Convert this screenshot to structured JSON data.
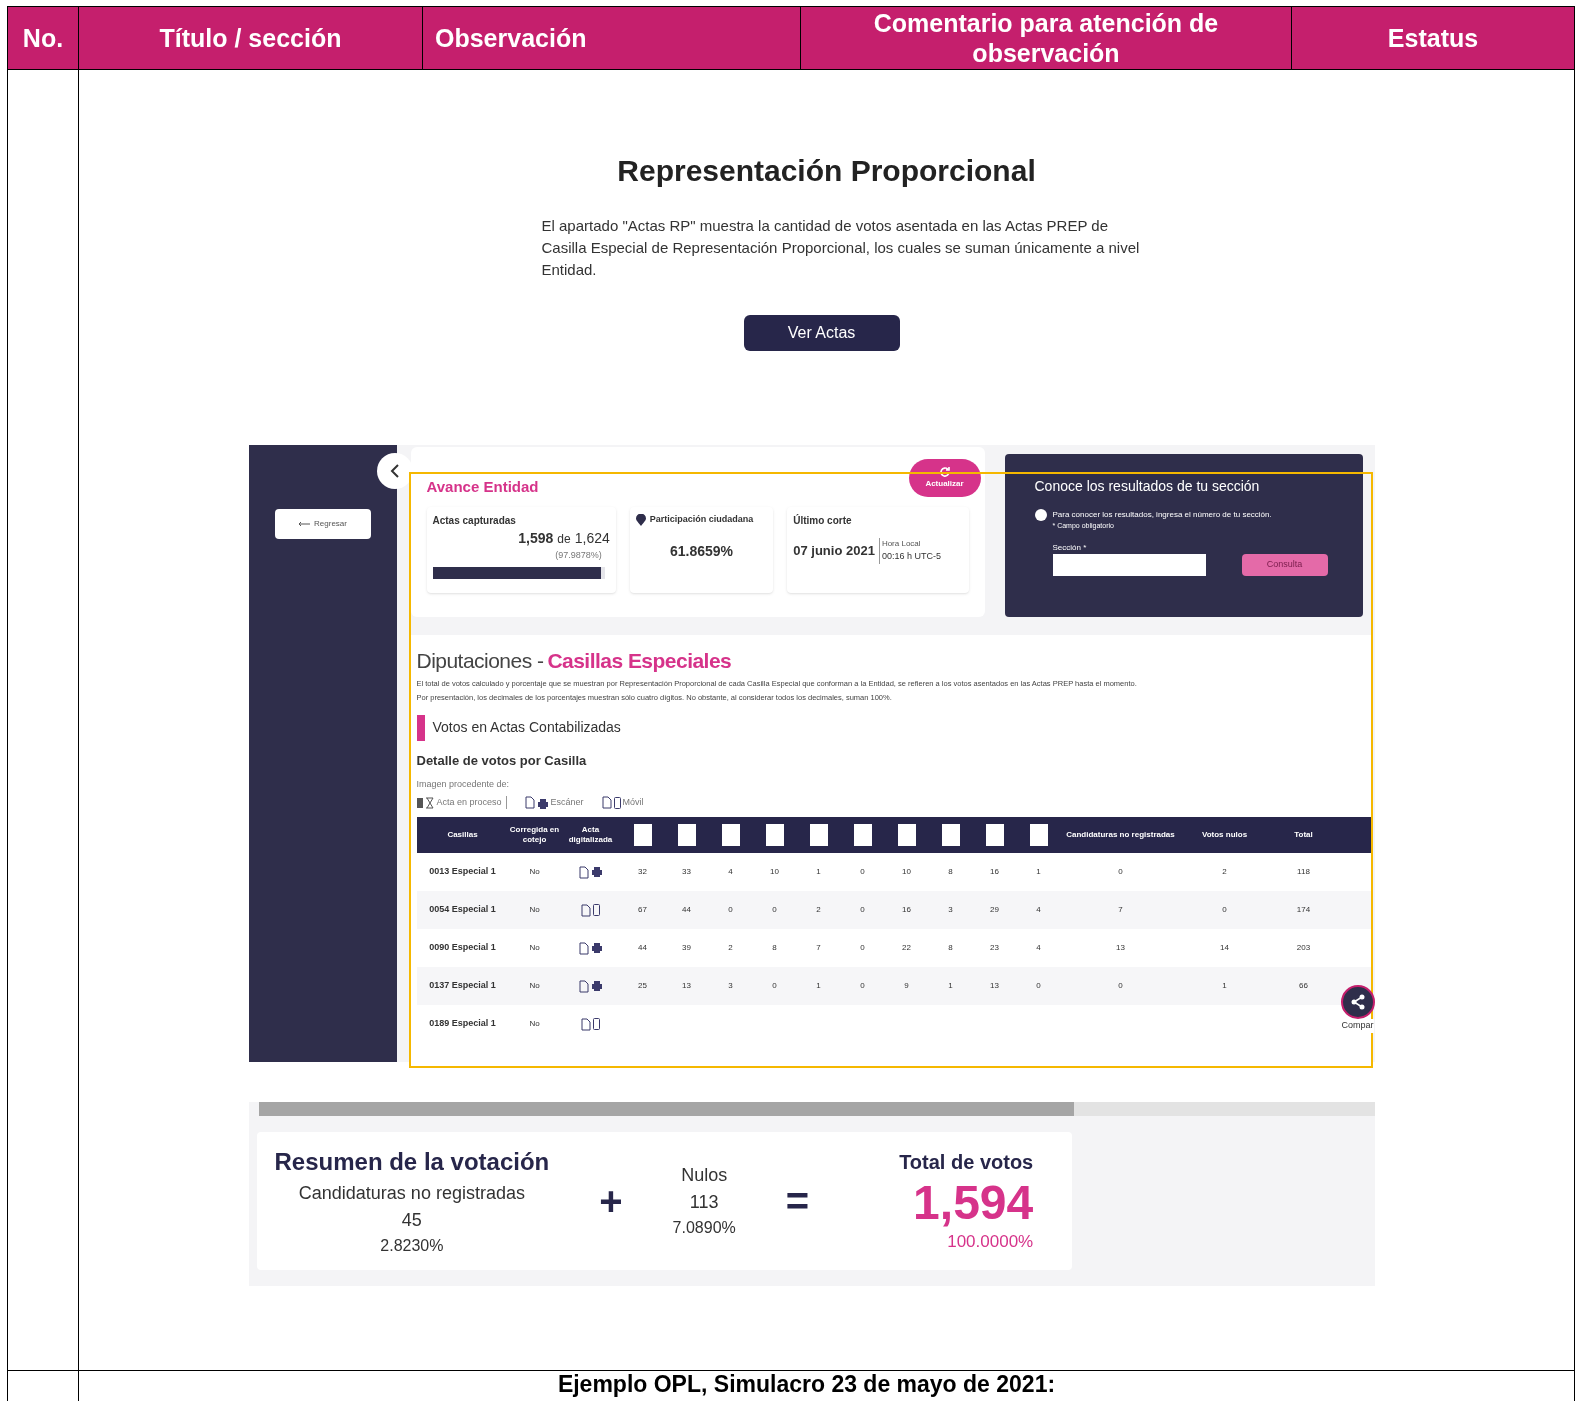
{
  "doc_table": {
    "columns": [
      "No.",
      "Título / sección",
      "Observación",
      "Comentario para atención de observación",
      "Estatus"
    ],
    "embedded_page": {
      "title": "Representación Proporcional",
      "description": "El apartado \"Actas RP\" muestra la cantidad de votos asentada en las Actas PREP de Casilla Especial de Representación Proporcional, los cuales se suman únicamente a nivel Entidad.",
      "button": "Ver Actas"
    },
    "app_screenshot": {
      "back_button": "Regresar",
      "avance": {
        "title": "Avance Entidad",
        "refresh_button": "Actualizar",
        "actas": {
          "label": "Actas capturadas",
          "count": "1,598",
          "of": "de",
          "total": "1,624",
          "percent": "(97.9878%)",
          "level": 0.98
        },
        "participacion": {
          "label": "Participación ciudadana",
          "value": "61.8659%"
        },
        "corte": {
          "label": "Último corte",
          "date": "07 junio 2021",
          "time_label": "Hora Local",
          "time": "00:16 h UTC-5"
        }
      },
      "seccion_panel": {
        "title": "Conoce los resultados de tu sección",
        "hint": "Para conocer los resultados, ingresa el número de tu sección.",
        "required_note": "* Campo obligatorio",
        "field_label": "Sección *",
        "button": "Consulta"
      },
      "diputaciones": {
        "title": "Diputaciones -",
        "title_highlight": "Casillas Especiales",
        "notes": [
          "El total de votos calculado y porcentaje que se muestran por Representación Proporcional de cada Casilla Especial que conforman a la Entidad, se refieren a los votos asentados en las Actas PREP hasta el momento.",
          "Por presentación, los decimales de los porcentajes muestran sólo cuatro dígitos. No obstante, al considerar todos los decimales, suman 100%."
        ],
        "subsection": "Votos en Actas Contabilizadas",
        "detail_title": "Detalle de votos por Casilla",
        "legend_label": "Imagen procedente de:",
        "legend": [
          {
            "kind": "proceso",
            "label": "Acta en proceso"
          },
          {
            "kind": "escaner",
            "label": "Escáner"
          },
          {
            "kind": "movil",
            "label": "Móvil"
          }
        ],
        "table": {
          "columns": [
            {
              "kind": "text",
              "label": "Casillas"
            },
            {
              "kind": "text",
              "label": "Corregida en cotejo"
            },
            {
              "kind": "text",
              "label": "Acta digitalizada"
            },
            {
              "kind": "logo"
            },
            {
              "kind": "logo"
            },
            {
              "kind": "logo"
            },
            {
              "kind": "logo"
            },
            {
              "kind": "logo"
            },
            {
              "kind": "logo"
            },
            {
              "kind": "logo"
            },
            {
              "kind": "logo"
            },
            {
              "kind": "logo"
            },
            {
              "kind": "logo"
            },
            {
              "kind": "text",
              "label": "Candidaturas no registradas"
            },
            {
              "kind": "text",
              "label": "Votos nulos"
            },
            {
              "kind": "text",
              "label": "Total"
            }
          ],
          "rows": [
            {
              "casilla": "0013 Especial 1",
              "corregida": "No",
              "kind": "escaner",
              "values": [
                "32",
                "33",
                "4",
                "10",
                "1",
                "0",
                "10",
                "8",
                "16",
                "1",
                "0",
                "2",
                "118"
              ]
            },
            {
              "casilla": "0054 Especial 1",
              "corregida": "No",
              "kind": "movil",
              "values": [
                "67",
                "44",
                "0",
                "0",
                "2",
                "0",
                "16",
                "3",
                "29",
                "4",
                "7",
                "0",
                "174"
              ]
            },
            {
              "casilla": "0090 Especial 1",
              "corregida": "No",
              "kind": "escaner",
              "values": [
                "44",
                "39",
                "2",
                "8",
                "7",
                "0",
                "22",
                "8",
                "23",
                "4",
                "13",
                "14",
                "203"
              ]
            },
            {
              "casilla": "0137 Especial 1",
              "corregida": "No",
              "kind": "escaner",
              "values": [
                "25",
                "13",
                "3",
                "0",
                "1",
                "0",
                "9",
                "1",
                "13",
                "0",
                "0",
                "1",
                "66"
              ]
            },
            {
              "casilla": "0189 Especial 1",
              "corregida": "No",
              "kind": "movil",
              "values": []
            }
          ]
        },
        "share_label": "Compar"
      }
    },
    "resumen": {
      "title": "Resumen de la votación",
      "items": [
        {
          "kind": "item",
          "label": "Candidaturas no registradas",
          "value": "45",
          "percent": "2.8230%"
        },
        {
          "kind": "operator",
          "symbol": "+"
        },
        {
          "kind": "item",
          "label": "Nulos",
          "value": "113",
          "percent": "7.0890%"
        },
        {
          "kind": "operator",
          "symbol": "="
        },
        {
          "kind": "total",
          "label": "Total de votos",
          "value": "1,594",
          "percent": "100.0000%"
        }
      ]
    },
    "footer_row": "Ejemplo OPL, Simulacro 23 de mayo de 2021:"
  }
}
